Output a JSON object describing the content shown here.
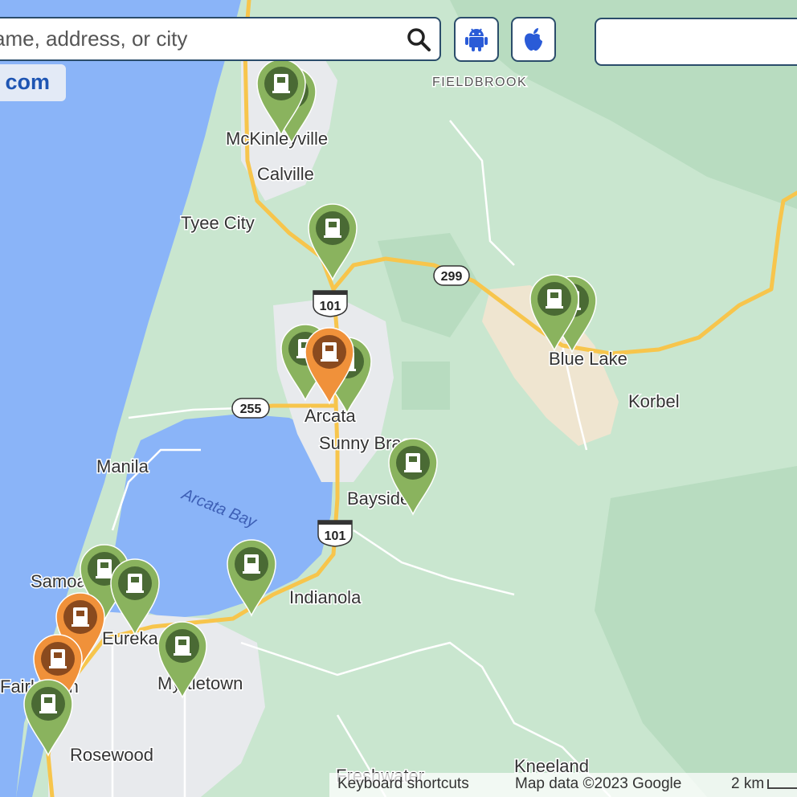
{
  "search": {
    "placeholder": "ame, address, or city"
  },
  "site_link": "com",
  "app_buttons": {
    "android_icon": "android-icon",
    "apple_icon": "apple-icon"
  },
  "places": {
    "fieldbrook": "FIELDBROOK",
    "mckinleyville": "McKinleyville",
    "calville": "Calville",
    "tyee_city": "Tyee City",
    "blue_lake": "Blue Lake",
    "korbel": "Korbel",
    "arcata": "Arcata",
    "sunny_brae": "Sunny Brae",
    "manila": "Manila",
    "bayside": "Bayside",
    "arcata_bay": "Arcata Bay",
    "samoa": "Samoa",
    "indianola": "Indianola",
    "eureka": "Eureka",
    "myrtletown": "Myrtletown",
    "fairhaven": "Fairhaven",
    "rosewood": "Rosewood",
    "kneeland": "Kneeland",
    "freshwater": "Freshwater"
  },
  "routes": {
    "r299": "299",
    "r101_north": "101",
    "r255": "255",
    "r101_south": "101"
  },
  "markers": [
    {
      "id": "mckinleyville-1",
      "status": "available",
      "color": "#8ab35e"
    },
    {
      "id": "mckinleyville-2",
      "status": "available",
      "color": "#8ab35e"
    },
    {
      "id": "hwy101-north",
      "status": "available",
      "color": "#8ab35e"
    },
    {
      "id": "blue-lake-1",
      "status": "available",
      "color": "#8ab35e"
    },
    {
      "id": "blue-lake-2",
      "status": "available",
      "color": "#8ab35e"
    },
    {
      "id": "arcata-1",
      "status": "available",
      "color": "#8ab35e"
    },
    {
      "id": "arcata-2",
      "status": "available",
      "color": "#8ab35e"
    },
    {
      "id": "arcata-3",
      "status": "in-use",
      "color": "#f0913a"
    },
    {
      "id": "bayside",
      "status": "available",
      "color": "#8ab35e"
    },
    {
      "id": "indianola",
      "status": "available",
      "color": "#8ab35e"
    },
    {
      "id": "samoa-1",
      "status": "available",
      "color": "#8ab35e"
    },
    {
      "id": "eureka-1",
      "status": "available",
      "color": "#8ab35e"
    },
    {
      "id": "eureka-2",
      "status": "in-use",
      "color": "#f0913a"
    },
    {
      "id": "myrtletown",
      "status": "available",
      "color": "#8ab35e"
    },
    {
      "id": "fairhaven-1",
      "status": "in-use",
      "color": "#f0913a"
    },
    {
      "id": "fairhaven-2",
      "status": "available",
      "color": "#8ab35e"
    }
  ],
  "footer": {
    "keyboard_shortcuts": "Keyboard shortcuts",
    "map_data": "Map data ©2023 Google",
    "scale": "2 km"
  },
  "colors": {
    "ocean": "#8ab4f8",
    "land": "#c9e6cf",
    "urban": "#e8eaed",
    "highway": "#f7c54c",
    "marker_available": "#8ab35e",
    "marker_in_use": "#f0913a",
    "marker_icon_dark": "#4a6a34",
    "marker_icon_orange_dark": "#8a4a1e"
  }
}
